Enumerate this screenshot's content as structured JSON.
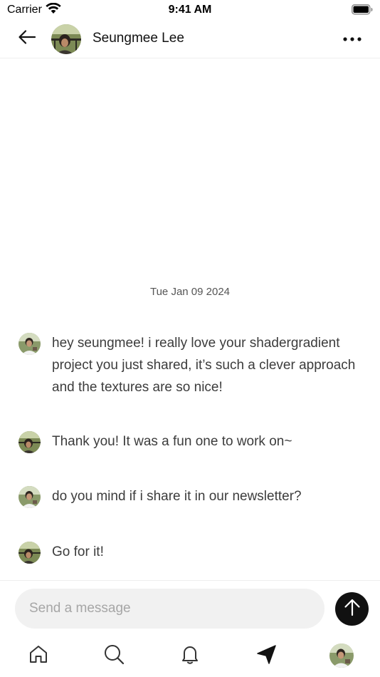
{
  "status_bar": {
    "carrier": "Carrier",
    "time": "9:41 AM",
    "icons": [
      "wifi-icon",
      "battery-icon"
    ]
  },
  "header": {
    "back_icon": "arrow-left-icon",
    "contact_name": "Seungmee Lee",
    "more_icon": "more-horizontal-icon"
  },
  "conversation": {
    "date_separator": "Tue Jan 09 2024",
    "messages": [
      {
        "sender": "me",
        "text": "hey seungmee! i really love your shadergradient project you just shared, it’s such a clever approach and the textures are so nice!"
      },
      {
        "sender": "contact",
        "text": "Thank you! It was a fun one to work on~"
      },
      {
        "sender": "me",
        "text": "do you mind if i share it in our newsletter?"
      },
      {
        "sender": "contact",
        "text": "Go for it!"
      }
    ]
  },
  "composer": {
    "placeholder": "Send a message",
    "value": "",
    "send_icon": "arrow-up-icon"
  },
  "tab_bar": {
    "items": [
      "home-icon",
      "search-icon",
      "bell-icon",
      "send-icon",
      "profile-avatar"
    ],
    "active": "send-icon"
  },
  "colors": {
    "accent": "#111111",
    "message_text": "#3c3c3c",
    "composer_bg": "#f1f1f1",
    "divider": "#eeeeee"
  }
}
